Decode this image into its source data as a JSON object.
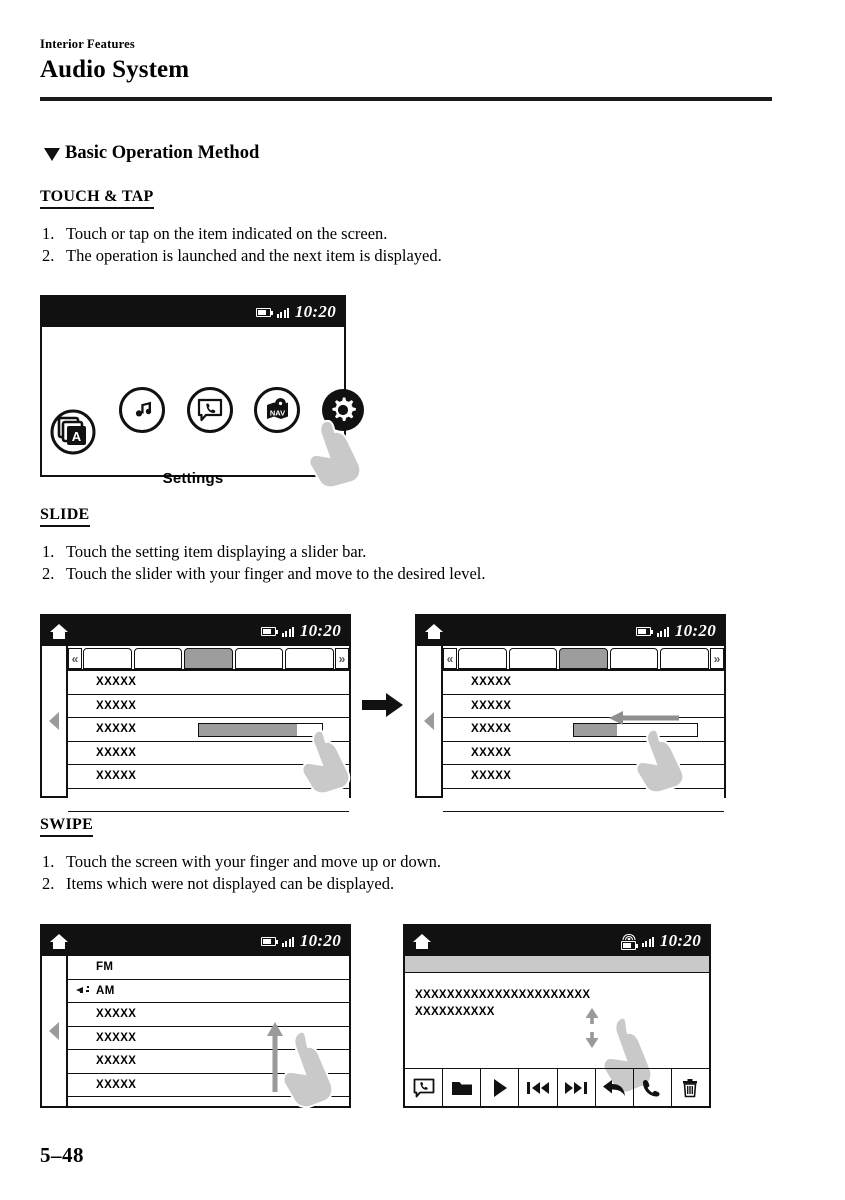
{
  "header": {
    "chapter": "Interior Features",
    "title": "Audio System"
  },
  "section": {
    "heading": "Basic Operation Method"
  },
  "folio": "5–48",
  "blocks": [
    {
      "id": "touch-tap",
      "heading": "TOUCH & TAP",
      "steps": [
        {
          "n": "1.",
          "text": "Touch or tap on the item indicated on the screen."
        },
        {
          "n": "2.",
          "text": "The operation is launched and the next item is displayed."
        }
      ]
    },
    {
      "id": "slide",
      "heading": "SLIDE",
      "steps": [
        {
          "n": "1.",
          "text": "Touch the setting item displaying a slider bar."
        },
        {
          "n": "2.",
          "text": "Touch the slider with your finger and move to the desired level."
        }
      ]
    },
    {
      "id": "swipe",
      "heading": "SWIPE",
      "steps": [
        {
          "n": "1.",
          "text": "Touch the screen with your finger and move up or down."
        },
        {
          "n": "2.",
          "text": "Items which were not displayed can be displayed."
        }
      ]
    }
  ],
  "home_screen": {
    "status": {
      "clock": "10:20",
      "battery_icon": "battery-icon",
      "signal_icon": "signal-bars-icon"
    },
    "apps": [
      {
        "name": "applications-icon",
        "label": ""
      },
      {
        "name": "music-note-icon",
        "label": ""
      },
      {
        "name": "phone-bubble-icon",
        "label": ""
      },
      {
        "name": "navigation-icon",
        "label": "NAV"
      },
      {
        "name": "gear-icon",
        "label": ""
      }
    ],
    "selected_label": "Settings"
  },
  "slide_before": {
    "status": {
      "clock": "10:20"
    },
    "tabs": [
      {
        "label": "",
        "active": false
      },
      {
        "label": "",
        "active": false
      },
      {
        "label": "",
        "active": true
      },
      {
        "label": "",
        "active": false
      },
      {
        "label": "",
        "active": false
      }
    ],
    "tab_prev": "«",
    "tab_next": "»",
    "rows": [
      {
        "label": "XXXXX",
        "slider": null
      },
      {
        "label": "XXXXX",
        "slider": null
      },
      {
        "label": "XXXXX",
        "slider": 80
      },
      {
        "label": "XXXXX",
        "slider": null
      },
      {
        "label": "XXXXX",
        "slider": null
      }
    ]
  },
  "slide_after": {
    "status": {
      "clock": "10:20"
    },
    "tabs": [
      {
        "label": "",
        "active": false
      },
      {
        "label": "",
        "active": false
      },
      {
        "label": "",
        "active": true
      },
      {
        "label": "",
        "active": false
      },
      {
        "label": "",
        "active": false
      }
    ],
    "tab_prev": "«",
    "tab_next": "»",
    "rows": [
      {
        "label": "XXXXX",
        "slider": null
      },
      {
        "label": "XXXXX",
        "slider": null
      },
      {
        "label": "XXXXX",
        "slider": 35
      },
      {
        "label": "XXXXX",
        "slider": null
      },
      {
        "label": "XXXXX",
        "slider": null
      }
    ]
  },
  "swipe_list": {
    "status": {
      "clock": "10:20"
    },
    "rows": [
      {
        "label": "FM",
        "icon": null
      },
      {
        "label": "AM",
        "icon": "speaker-icon"
      },
      {
        "label": "XXXXX",
        "icon": null
      },
      {
        "label": "XXXXX",
        "icon": null
      },
      {
        "label": "XXXXX",
        "icon": null
      },
      {
        "label": "XXXXX",
        "icon": null
      }
    ]
  },
  "swipe_media": {
    "status": {
      "clock": "10:20",
      "wifi_icon": "wifi-icon"
    },
    "text_line1": "XXXXXXXXXXXXXXXXXXXXXX",
    "text_line2": "XXXXXXXXXX",
    "toolbar": [
      {
        "name": "message-call-icon"
      },
      {
        "name": "folder-icon"
      },
      {
        "name": "play-icon"
      },
      {
        "name": "previous-track-icon"
      },
      {
        "name": "next-track-icon"
      },
      {
        "name": "back-arrow-icon"
      },
      {
        "name": "phone-icon"
      },
      {
        "name": "trash-icon"
      }
    ]
  },
  "transition_arrow": "right-arrow-icon"
}
